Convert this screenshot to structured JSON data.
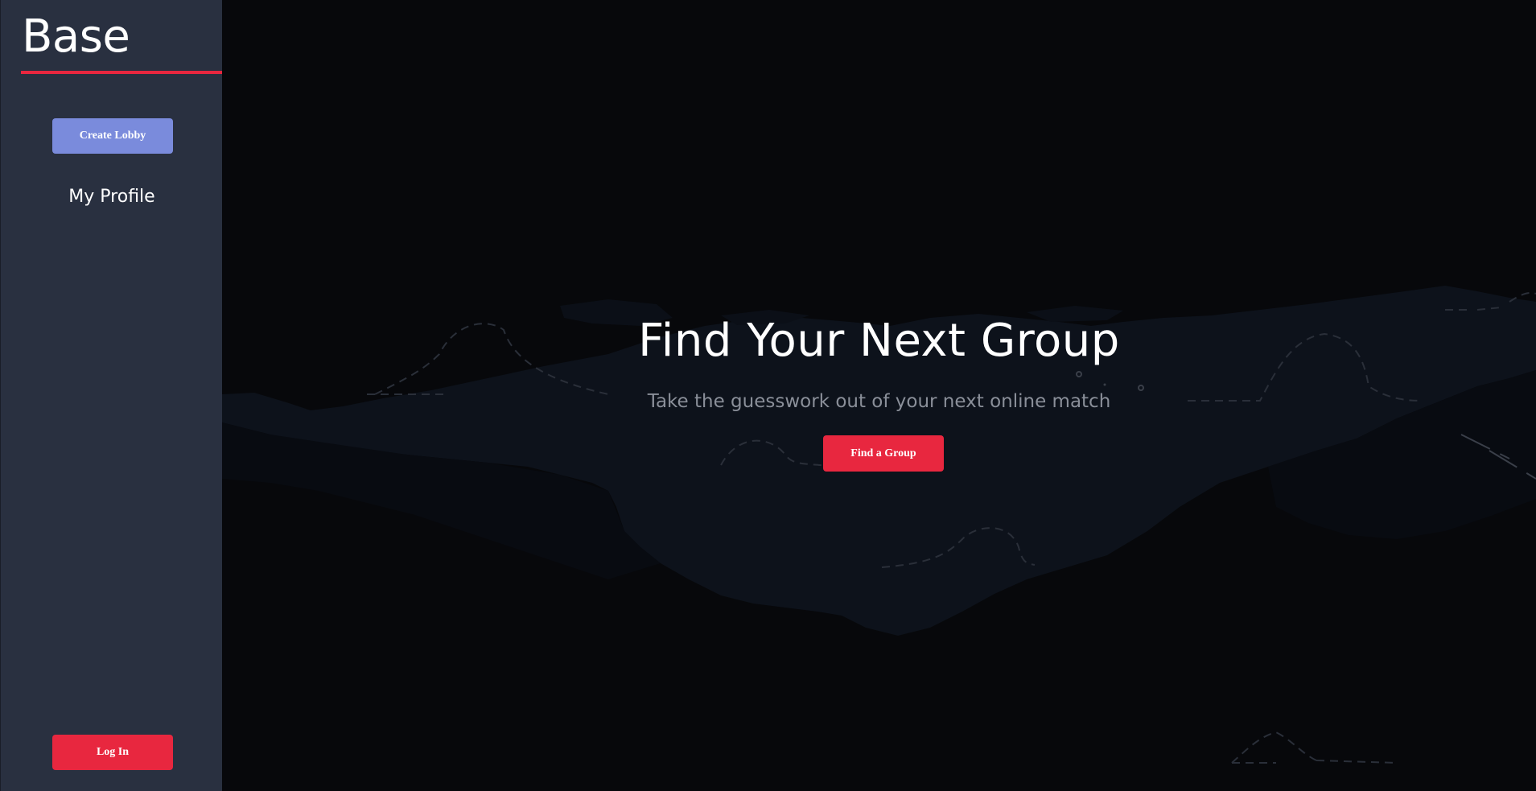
{
  "sidebar": {
    "brand": "Base",
    "create_lobby_label": "Create Lobby",
    "profile_label": "My Profile",
    "login_label": "Log In"
  },
  "hero": {
    "title": "Find Your Next Group",
    "subtitle": "Take the guesswork out of your next online match",
    "cta_label": "Find a Group"
  },
  "colors": {
    "accent": "#e8273f",
    "primary": "#7a8bdc",
    "sidebar_bg": "#293040",
    "main_bg": "#07080b"
  }
}
